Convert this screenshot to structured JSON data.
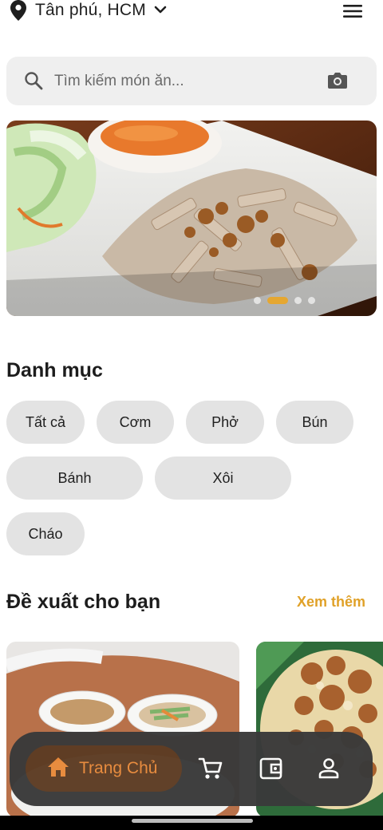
{
  "location": {
    "label": "Tân phú, HCM"
  },
  "search": {
    "placeholder": "Tìm kiếm món ăn..."
  },
  "banner": {
    "slides": 4,
    "active_slide": 2
  },
  "categories": {
    "title": "Danh mục",
    "items": [
      "Tất cả",
      "Cơm",
      "Phở",
      "Bún",
      "Bánh",
      "Xôi",
      "Cháo"
    ]
  },
  "recommend": {
    "title": "Đề xuất cho bạn",
    "see_more": "Xem thêm"
  },
  "nav": {
    "home_label": "Trang Chủ"
  },
  "colors": {
    "accent": "#e0a128",
    "nav_bg": "#3a3a3a",
    "nav_active": "#e8893a",
    "chip_bg": "#e3e3e3"
  },
  "icons": [
    "location-pin-icon",
    "chevron-down-icon",
    "menu-icon",
    "search-icon",
    "camera-icon",
    "home-icon",
    "cart-icon",
    "wallet-icon",
    "profile-icon"
  ]
}
